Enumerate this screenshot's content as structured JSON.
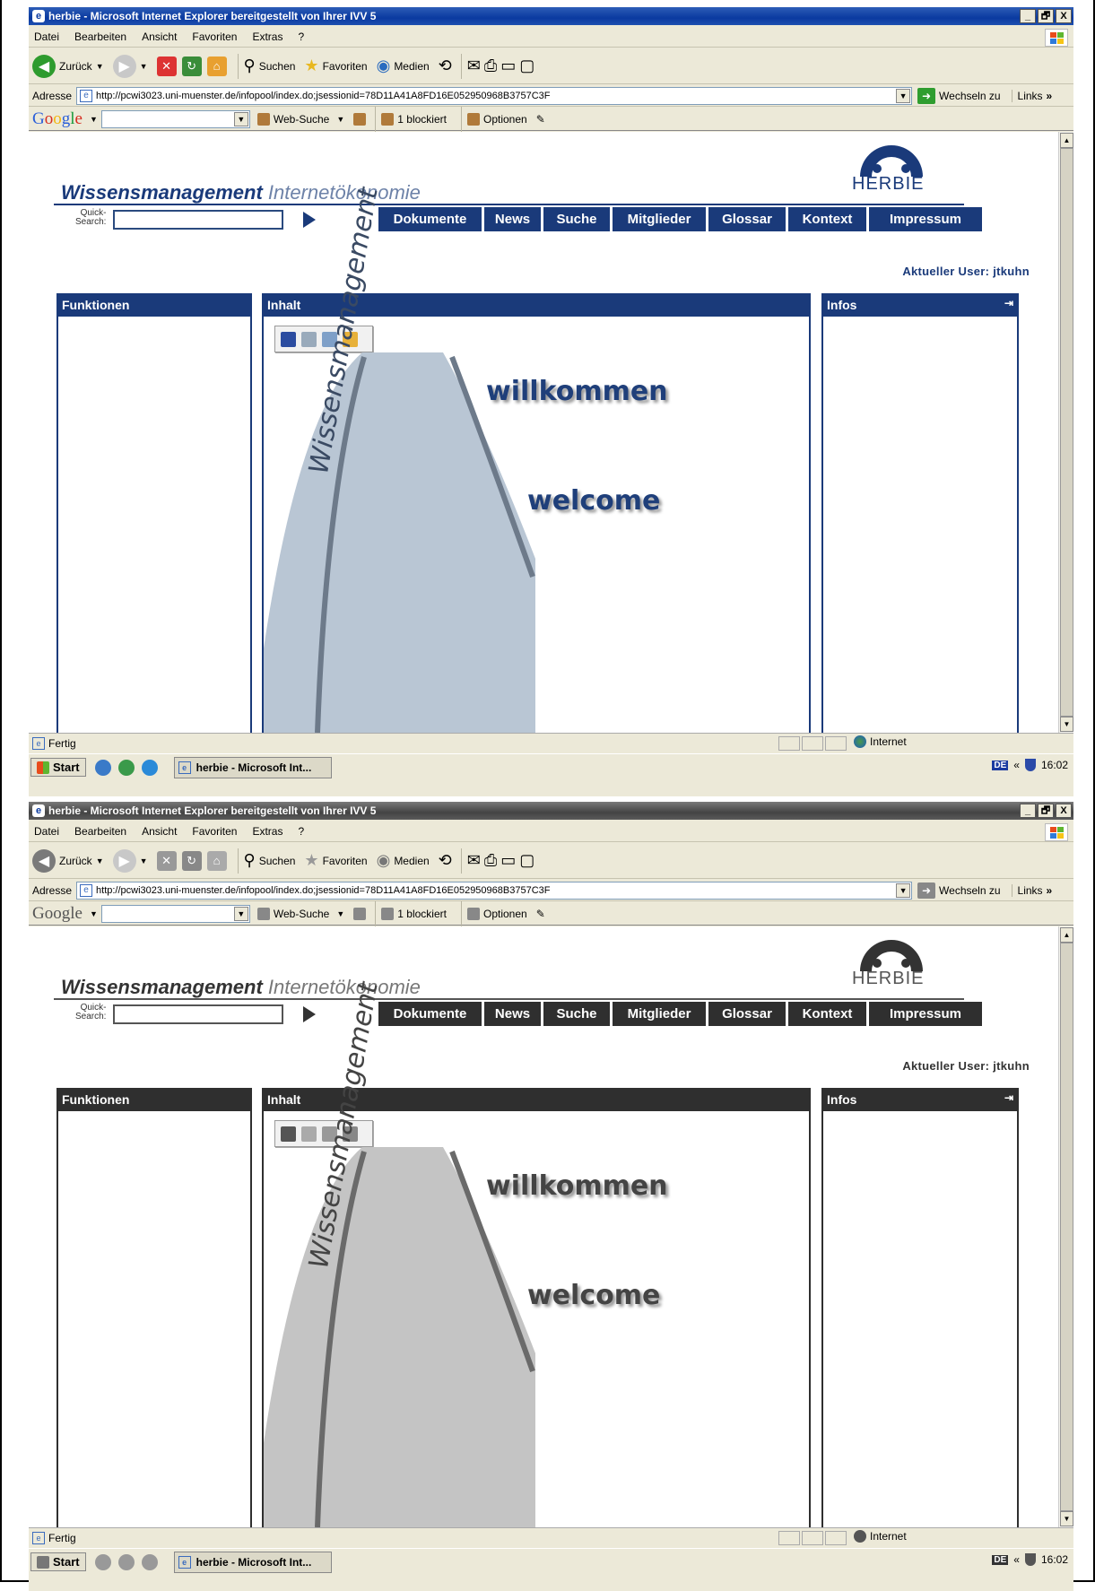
{
  "browser": {
    "title": "herbie - Microsoft Internet Explorer bereitgestellt von Ihrer IVV 5",
    "window_buttons": [
      "_",
      "🗗",
      "X"
    ],
    "menu": [
      "Datei",
      "Bearbeiten",
      "Ansicht",
      "Favoriten",
      "Extras",
      "?"
    ],
    "toolbar": {
      "back": "Zurück",
      "search": "Suchen",
      "favorites": "Favoriten",
      "media": "Medien"
    },
    "address": {
      "label": "Adresse",
      "url": "http://pcwi3023.uni-muenster.de/infopool/index.do;jsessionid=78D11A41A8FD16E052950968B3757C3F",
      "go": "Wechseln zu",
      "links": "Links"
    },
    "google": {
      "logo": "Google",
      "web_search": "Web-Suche",
      "blocked": "1 blockiert",
      "options": "Optionen"
    },
    "status": {
      "text": "Fertig",
      "zone": "Internet"
    }
  },
  "taskbar": {
    "start": "Start",
    "task": "herbie - Microsoft Int...",
    "lang": "DE",
    "chevron": "«",
    "time": "16:02"
  },
  "site": {
    "brand_bold": "Wissensmanagement",
    "brand_light": "Internetökonomie",
    "logo_text": "HERBIE",
    "quick_search_label": "Quick-\nSearch:",
    "nav": [
      "Dokumente",
      "News",
      "Suche",
      "Mitglieder",
      "Glossar",
      "Kontext",
      "Impressum"
    ],
    "user": "Aktueller User: jtkuhn",
    "panels": {
      "functions": "Funktionen",
      "content": "Inhalt",
      "infos": "Infos"
    },
    "welcome_de": "willkommen",
    "welcome_en": "welcome",
    "welcome_vertical": "Wissensmanagement"
  },
  "colors": {
    "accent_color_view": "#1a3a7a",
    "accent_grayscale_view": "#2f2f2f"
  }
}
